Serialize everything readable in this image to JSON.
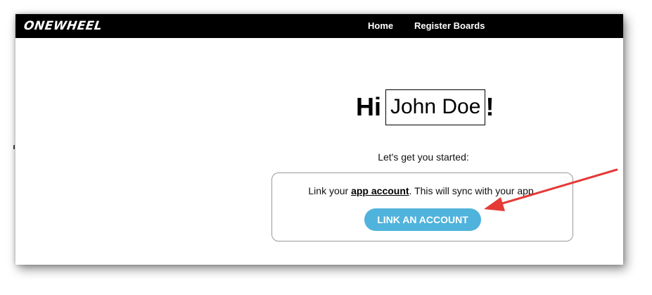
{
  "navbar": {
    "logo": "ONEWHEEL",
    "links": [
      {
        "label": "Home"
      },
      {
        "label": "Register Boards"
      }
    ]
  },
  "greeting": {
    "prefix": "Hi",
    "name": "John Doe",
    "suffix": "!"
  },
  "subtitle": "Let's get you started:",
  "card": {
    "text_before": "Link your ",
    "link_label": "app account",
    "text_after": ". This will sync with your app.",
    "button_label": "LINK AN ACCOUNT"
  },
  "colors": {
    "navbar_bg": "#000000",
    "button_bg": "#4fb3dc",
    "annotation_arrow": "#e53935"
  },
  "annotation": {
    "type": "arrow",
    "icon": "red-arrow-icon",
    "target": "link-account-button"
  }
}
